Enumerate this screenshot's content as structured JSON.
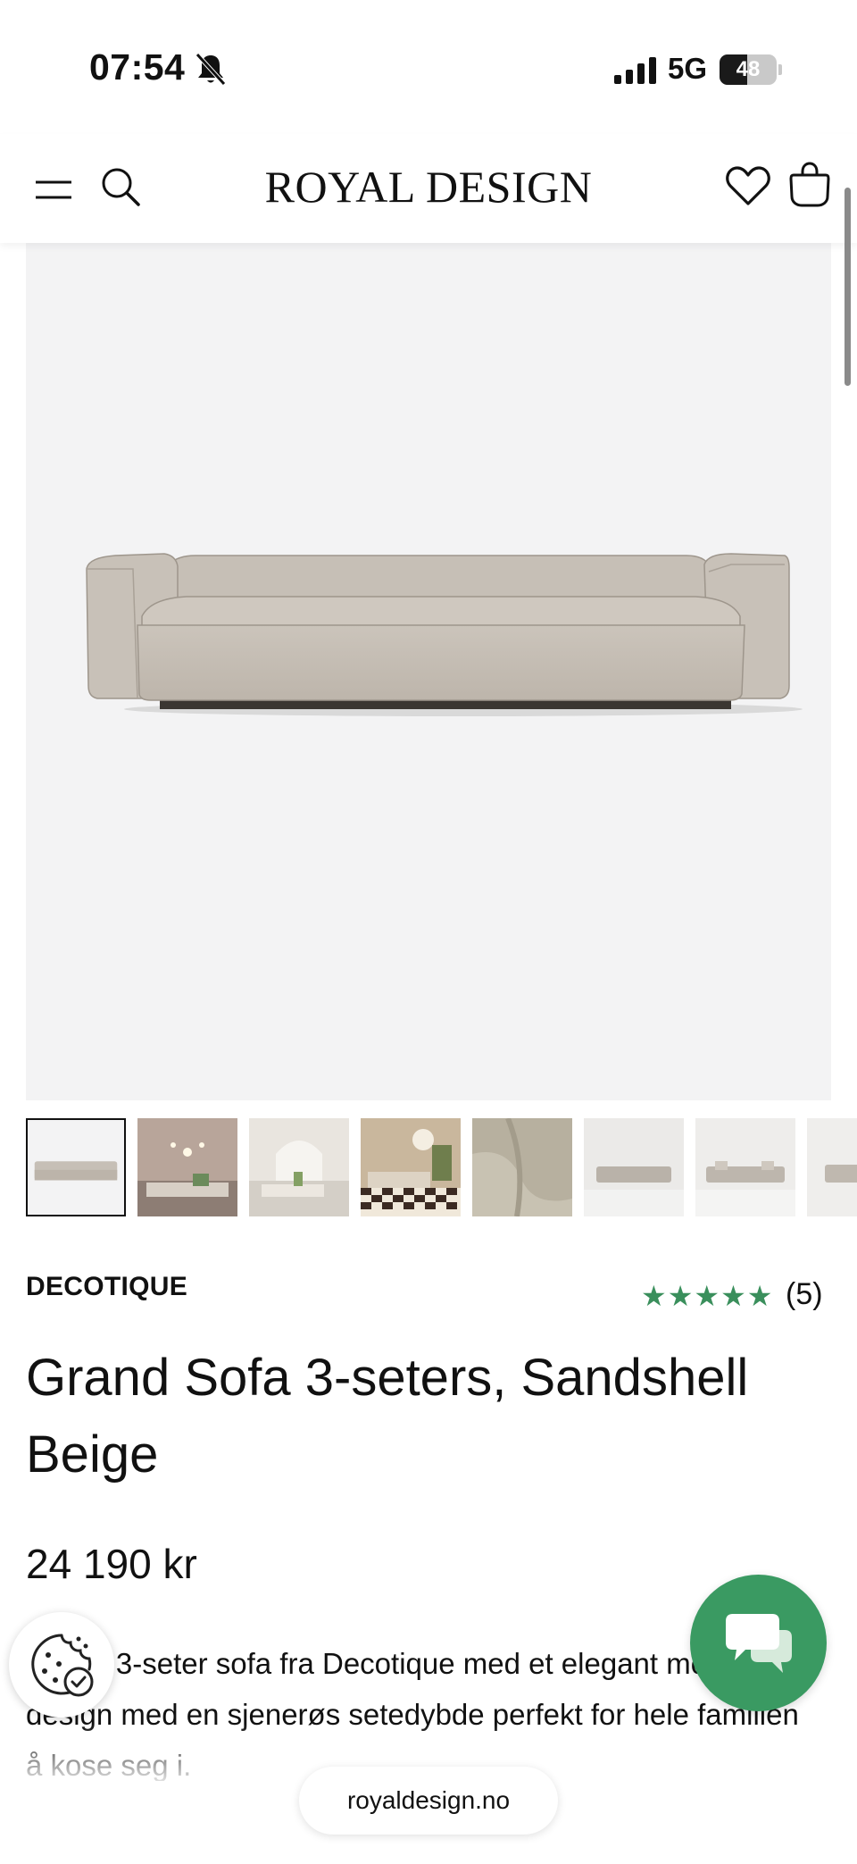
{
  "status_bar": {
    "time": "07:54",
    "network": "5G",
    "battery_level": "48",
    "battery_fraction": 0.48,
    "icons": [
      "bell-slash-icon",
      "signal-icon",
      "battery-icon"
    ]
  },
  "header": {
    "logo": "ROYAL DESIGN",
    "icons": [
      "menu-icon",
      "search-icon",
      "heart-icon",
      "bag-icon"
    ]
  },
  "gallery": {
    "thumbnails": [
      {
        "label": "sofa-front"
      },
      {
        "label": "living-room-lamp"
      },
      {
        "label": "living-room-arch"
      },
      {
        "label": "living-room-checkered-rug"
      },
      {
        "label": "fabric-closeup"
      },
      {
        "label": "sofa-angle"
      },
      {
        "label": "sofa-with-cushions"
      },
      {
        "label": "sofa-side"
      }
    ]
  },
  "product": {
    "brand": "DECOTIQUE",
    "stars": "★★★★★",
    "rating": 5,
    "review_count": "(5)",
    "title": "Grand Sofa 3-seters, Sandshell Beige",
    "price": "24 190 kr",
    "description": "Grand 3-seter sofa fra Decotique med et elegant moderne design med en sjenerøs setedybde perfekt for hele familien å kose seg i."
  },
  "browser": {
    "url": "royaldesign.no"
  },
  "colors": {
    "accent_green": "#3a9a62",
    "star_green": "#3a8f5c",
    "image_bg": "#f3f3f4",
    "sofa": "#c9c1b8"
  }
}
